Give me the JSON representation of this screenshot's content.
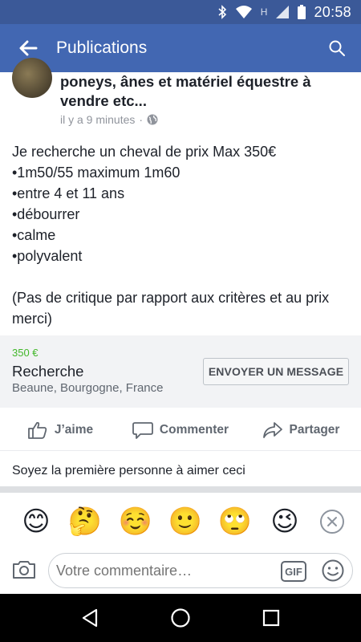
{
  "status_bar": {
    "time": "20:58",
    "network_letter": "H"
  },
  "app_bar": {
    "title": "Publications"
  },
  "post": {
    "group_name": "poneys, ânes et matériel équestre à vendre etc...",
    "timestamp": "il y a 9 minutes",
    "separator": "·",
    "body_lines": [
      "Je recherche un cheval de prix Max 350€",
      "•1m50/55 maximum 1m60",
      "•entre 4 et 11 ans",
      "•débourrer",
      "•calme",
      "•polyvalent",
      "",
      "(Pas de critique par rapport aux critères et au prix merci)"
    ]
  },
  "listing": {
    "price": "350 €",
    "title": "Recherche",
    "location": "Beaune, Bourgogne, France",
    "message_button": "ENVOYER UN MESSAGE"
  },
  "actions": {
    "like": "J’aime",
    "comment": "Commenter",
    "share": "Partager"
  },
  "likes_line": "Soyez la première personne à aimer ceci",
  "emojis": [
    "😊",
    "🤔",
    "☺️",
    "🙂",
    "🙄",
    "😉"
  ],
  "composer": {
    "placeholder": "Votre commentaire…",
    "gif_label": "GIF"
  },
  "colors": {
    "header": "#4267b2",
    "status": "#3b5998",
    "price": "#42b72a"
  }
}
